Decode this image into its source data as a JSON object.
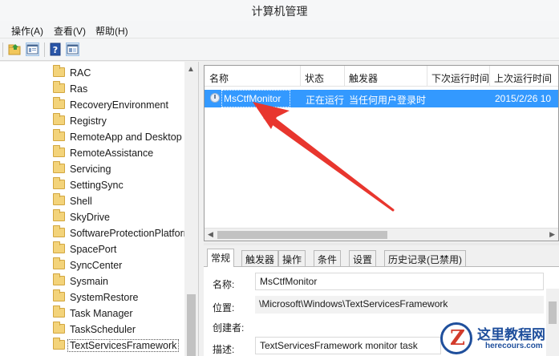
{
  "window": {
    "title": "计算机管理"
  },
  "menu": [
    {
      "label": "操作(A)"
    },
    {
      "label": "查看(V)"
    },
    {
      "label": "帮助(H)"
    }
  ],
  "toolbar": {
    "icons": [
      "folder-up-icon",
      "show-hide-tree-icon",
      "help-icon",
      "properties-icon"
    ]
  },
  "tree": {
    "items": [
      {
        "label": "RAC"
      },
      {
        "label": "Ras"
      },
      {
        "label": "RecoveryEnvironment"
      },
      {
        "label": "Registry"
      },
      {
        "label": "RemoteApp and Desktop"
      },
      {
        "label": "RemoteAssistance"
      },
      {
        "label": "Servicing"
      },
      {
        "label": "SettingSync"
      },
      {
        "label": "Shell"
      },
      {
        "label": "SkyDrive"
      },
      {
        "label": "SoftwareProtectionPlatforr"
      },
      {
        "label": "SpacePort"
      },
      {
        "label": "SyncCenter"
      },
      {
        "label": "Sysmain"
      },
      {
        "label": "SystemRestore"
      },
      {
        "label": "Task Manager"
      },
      {
        "label": "TaskScheduler"
      },
      {
        "label": "TextServicesFramework"
      }
    ],
    "selected": "TextServicesFramework"
  },
  "task_list": {
    "columns": [
      "名称",
      "状态",
      "触发器",
      "下次运行时间",
      "上次运行时间"
    ],
    "rows": [
      {
        "name": "MsCtfMonitor",
        "status": "正在运行",
        "trigger": "当任何用户登录时",
        "next_run": "",
        "last_run": "2015/2/26 10"
      }
    ]
  },
  "details": {
    "tabs": [
      "常规",
      "触发器",
      "操作",
      "条件",
      "设置",
      "历史记录(已禁用)"
    ],
    "active_tab": "常规",
    "fields": {
      "name_label": "名称:",
      "name_value": "MsCtfMonitor",
      "location_label": "位置:",
      "location_value": "\\Microsoft\\Windows\\TextServicesFramework",
      "author_label": "创建者:",
      "author_value": "",
      "description_label": "描述:",
      "description_value": "TextServicesFramework monitor task"
    }
  },
  "annotation": {
    "arrow_color": "#e8362e"
  },
  "watermark": {
    "text": "这里教程网",
    "url": "herecours.com"
  },
  "colors": {
    "selection": "#3399ff",
    "folder": "#f3d37a"
  }
}
